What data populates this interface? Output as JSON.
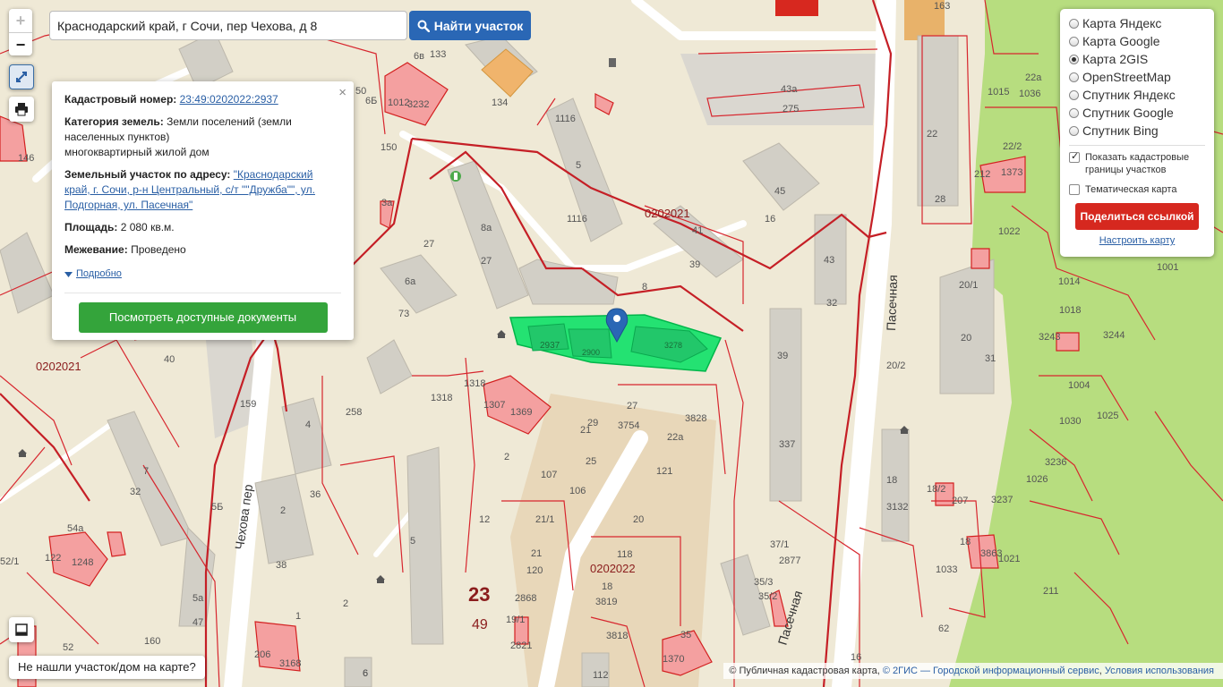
{
  "search": {
    "value": "Краснодарский край, г Сочи, пер Чехова, д 8",
    "button_label": "Найти участок"
  },
  "zoom": {
    "in": "+",
    "out": "−"
  },
  "popup": {
    "cad_label": "Кадастровый номер:",
    "cad_value": "23:49:0202022:2937",
    "cat_label": "Категория земель:",
    "cat_value": "Земли поселений (земли населенных пунктов)",
    "use_value": "многоквартирный жилой дом",
    "addr_label": "Земельный участок по адресу:",
    "addr_value": "\"Краснодарский край, г. Сочи, р-н Центральный, с/т \"\"Дружба\"\", ул. Подгорная, ул. Пасечная\"",
    "area_label": "Площадь:",
    "area_value": "2 080 кв.м.",
    "survey_label": "Межевание:",
    "survey_value": "Проведено",
    "more_label": "Подробно",
    "docs_button": "Посмотреть доступные документы",
    "close": "×"
  },
  "layers": {
    "options": [
      {
        "label": "Карта Яндекс",
        "selected": false
      },
      {
        "label": "Карта Google",
        "selected": false
      },
      {
        "label": "Карта 2GIS",
        "selected": true
      },
      {
        "label": "OpenStreetMap",
        "selected": false
      },
      {
        "label": "Спутник Яндекс",
        "selected": false
      },
      {
        "label": "Спутник Google",
        "selected": false
      },
      {
        "label": "Спутник Bing",
        "selected": false
      }
    ],
    "show_borders_label": "Показать кадастровые границы участков",
    "show_borders_checked": true,
    "thematic_label": "Тематическая карта",
    "thematic_checked": false,
    "share_button": "Поделиться ссылкой",
    "setup_link": "Настроить карту"
  },
  "not_found_button": "Не нашли участок/дом на карте?",
  "attribution": {
    "prefix": "© Публичная кадастровая карта,",
    "gis_link": "© 2ГИС — Городской информационный сервис",
    "terms_link": "Условия использования"
  },
  "map": {
    "streets": {
      "chekhova": "Чехова пер",
      "pasechnaya_top": "Пасечная",
      "pasechnaya_bottom": "Пасечная"
    },
    "quarters": {
      "q1": "0202021",
      "q2": "0202021",
      "q3": "0202022"
    },
    "big_labels": {
      "district": "23",
      "district_sub": "49"
    },
    "selected_parcel": [
      "2937",
      "2900",
      "3278"
    ],
    "labels": [
      "163",
      "6в",
      "133",
      "6Б",
      "1012",
      "3232",
      "134",
      "1116",
      "43а",
      "275",
      "5",
      "1116",
      "22",
      "28",
      "1015",
      "1036",
      "22а",
      "22/2",
      "212",
      "1373",
      "1022",
      "1001",
      "1014",
      "1018",
      "3243",
      "3244",
      "20/1",
      "20",
      "31",
      "20/2",
      "1004",
      "1030",
      "1025",
      "3236",
      "1026",
      "3237",
      "18",
      "3132",
      "18/2",
      "207",
      "18",
      "3863",
      "1021",
      "1033",
      "211",
      "62",
      "39",
      "337",
      "37/1",
      "2877",
      "35/3",
      "35/2",
      "35",
      "1370",
      "16",
      "45",
      "16",
      "43",
      "32",
      "41",
      "39",
      "8а",
      "27",
      "8",
      "27",
      "6а",
      "73",
      "50",
      "146",
      "150",
      "3а",
      "40",
      "1318",
      "1318",
      "1307",
      "1369",
      "258",
      "4",
      "7",
      "32",
      "2",
      "36",
      "38",
      "5Б",
      "159",
      "54а",
      "122",
      "1248",
      "52/1",
      "5а",
      "47",
      "52",
      "206",
      "3168",
      "6",
      "1",
      "160",
      "27",
      "3754",
      "3828",
      "22а",
      "29",
      "21",
      "25",
      "2",
      "107",
      "106",
      "121",
      "20",
      "12",
      "21/1",
      "21",
      "120",
      "5",
      "118",
      "18",
      "3819",
      "3818",
      "112",
      "2821",
      "2868",
      "19/1",
      "2",
      "6"
    ]
  }
}
